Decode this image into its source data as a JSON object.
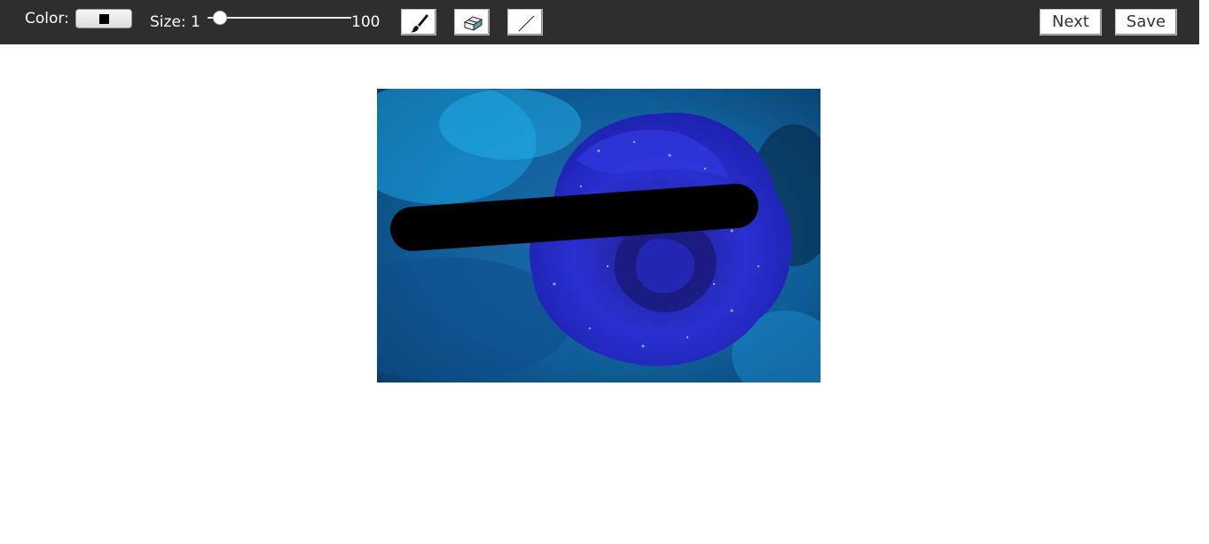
{
  "toolbar": {
    "color_label": "Color:",
    "current_color": "#000000",
    "size_label": "Size: 1",
    "size_max_label": "100",
    "size_value": 1,
    "size_min": 1,
    "size_max": 100,
    "tools": [
      {
        "name": "brush",
        "icon": "paintbrush-icon"
      },
      {
        "name": "eraser",
        "icon": "eraser-icon"
      },
      {
        "name": "line",
        "icon": "line-icon"
      }
    ],
    "next_label": "Next",
    "save_label": "Save",
    "background_color": "#2e2e2e"
  },
  "canvas": {
    "image_subject": "blue rose with water droplets",
    "stroke_color": "#000000"
  }
}
